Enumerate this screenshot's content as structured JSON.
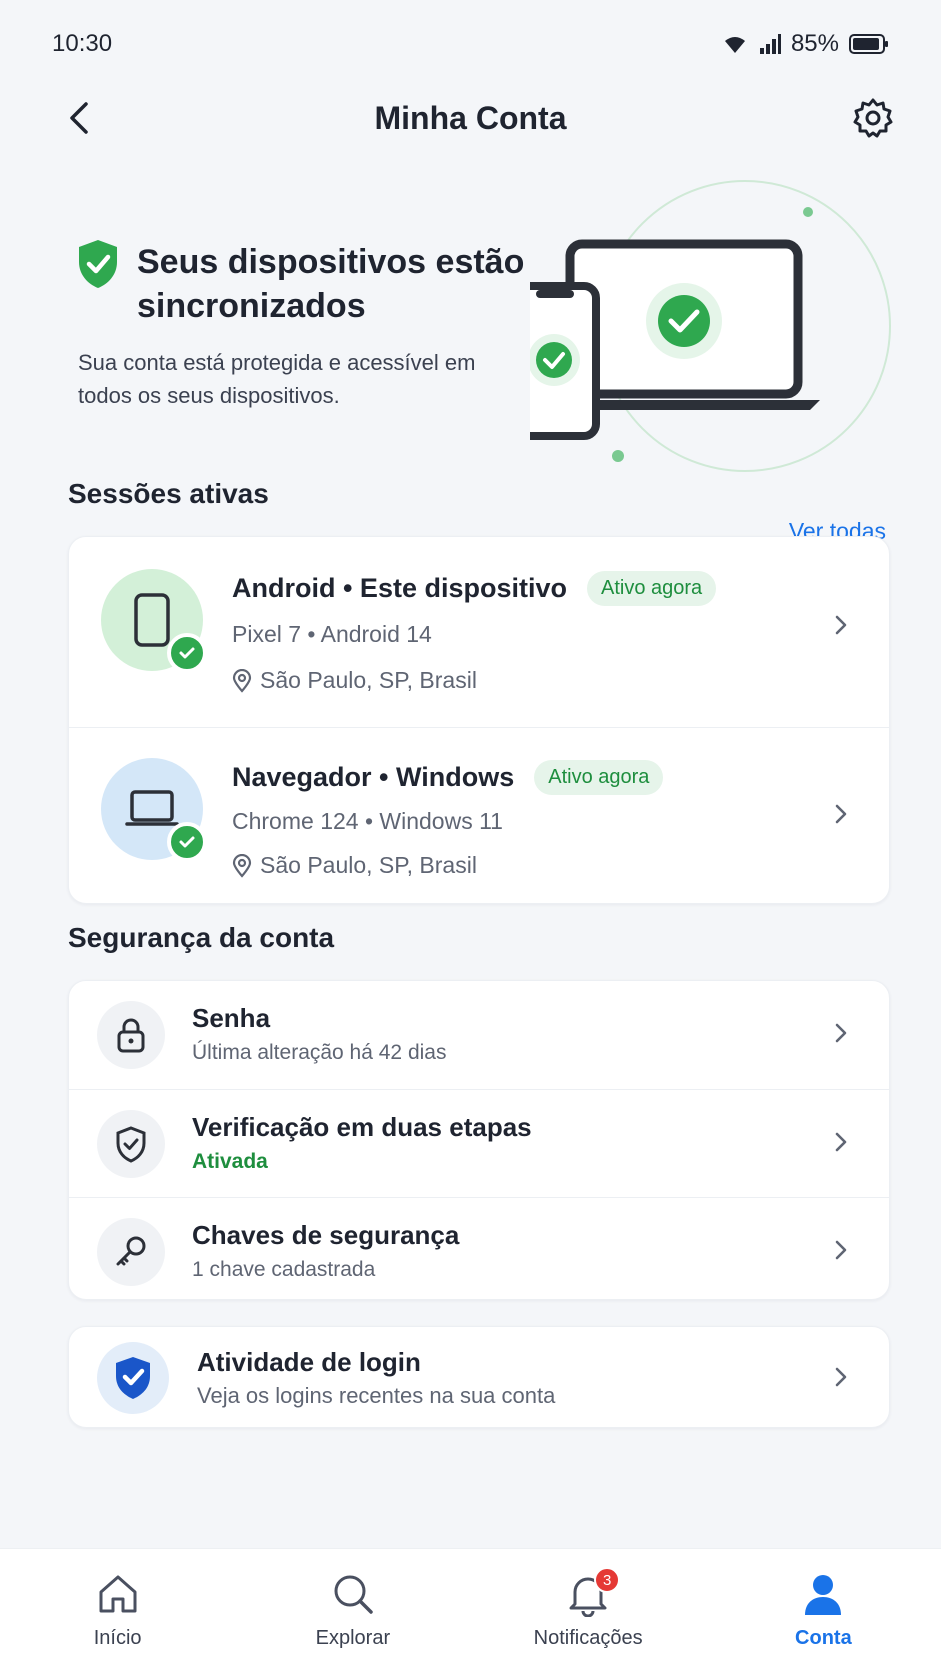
{
  "status_bar": {
    "time": "10:30",
    "battery": "85%"
  },
  "header": {
    "title": "Minha Conta"
  },
  "hero": {
    "title": "Seus dispositivos estão sincronizados",
    "description": "Sua conta está protegida e acessível em todos os seus dispositivos."
  },
  "sessions": {
    "title": "Sessões ativas",
    "see_all": "Ver todas",
    "items": [
      {
        "name": "Android • Este dispositivo",
        "badge": "Ativo agora",
        "details": "Pixel 7 • Android 14",
        "location": "São Paulo, SP, Brasil"
      },
      {
        "name": "Navegador • Windows",
        "badge": "Ativo agora",
        "details": "Chrome 124 • Windows 11",
        "location": "São Paulo, SP, Brasil"
      }
    ]
  },
  "security": {
    "title": "Segurança da conta",
    "items": [
      {
        "title": "Senha",
        "subtitle": "Última alteração há 42 dias"
      },
      {
        "title": "Verificação em duas etapas",
        "subtitle": "Ativada"
      },
      {
        "title": "Chaves de segurança",
        "subtitle": "1 chave cadastrada"
      }
    ]
  },
  "login_activity": {
    "title": "Atividade de login",
    "subtitle": "Veja os logins recentes na sua conta"
  },
  "bottom_nav": {
    "items": [
      {
        "label": "Início",
        "icon": "home-icon"
      },
      {
        "label": "Explorar",
        "icon": "search-icon"
      },
      {
        "label": "Notificações",
        "icon": "bell-icon",
        "badge": "3"
      },
      {
        "label": "Conta",
        "icon": "person-icon"
      }
    ]
  },
  "colors": {
    "accent": "#1a73e8",
    "success": "#2fa84f",
    "badge_bg": "#e6f4ea"
  }
}
